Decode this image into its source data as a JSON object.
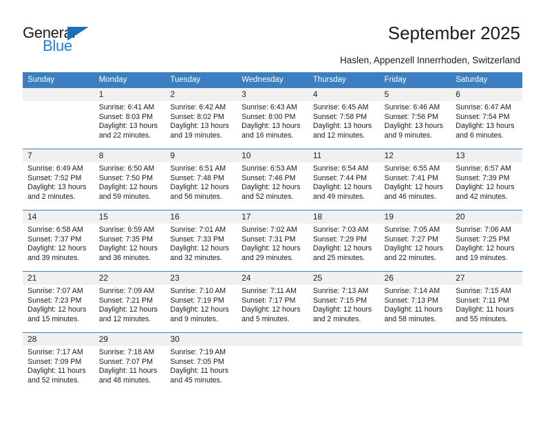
{
  "brand": {
    "word_one": "General",
    "word_two": "Blue",
    "triangle_icon": "triangle-icon",
    "accent_color": "#1c7fd6"
  },
  "header": {
    "title": "September 2025",
    "subtitle": "Haslen, Appenzell Innerrhoden, Switzerland"
  },
  "theme": {
    "header_blue": "#3c7fc1",
    "daynum_gray": "#f0f0f0",
    "text": "#1a1a1a"
  },
  "calendar": {
    "weekday_headers": [
      "Sunday",
      "Monday",
      "Tuesday",
      "Wednesday",
      "Thursday",
      "Friday",
      "Saturday"
    ],
    "weeks": [
      [
        {
          "day": "",
          "sunrise": "",
          "sunset": "",
          "daylight": "",
          "empty": true
        },
        {
          "day": "1",
          "sunrise": "Sunrise: 6:41 AM",
          "sunset": "Sunset: 8:03 PM",
          "daylight": "Daylight: 13 hours and 22 minutes."
        },
        {
          "day": "2",
          "sunrise": "Sunrise: 6:42 AM",
          "sunset": "Sunset: 8:02 PM",
          "daylight": "Daylight: 13 hours and 19 minutes."
        },
        {
          "day": "3",
          "sunrise": "Sunrise: 6:43 AM",
          "sunset": "Sunset: 8:00 PM",
          "daylight": "Daylight: 13 hours and 16 minutes."
        },
        {
          "day": "4",
          "sunrise": "Sunrise: 6:45 AM",
          "sunset": "Sunset: 7:58 PM",
          "daylight": "Daylight: 13 hours and 12 minutes."
        },
        {
          "day": "5",
          "sunrise": "Sunrise: 6:46 AM",
          "sunset": "Sunset: 7:56 PM",
          "daylight": "Daylight: 13 hours and 9 minutes."
        },
        {
          "day": "6",
          "sunrise": "Sunrise: 6:47 AM",
          "sunset": "Sunset: 7:54 PM",
          "daylight": "Daylight: 13 hours and 6 minutes."
        }
      ],
      [
        {
          "day": "7",
          "sunrise": "Sunrise: 6:49 AM",
          "sunset": "Sunset: 7:52 PM",
          "daylight": "Daylight: 13 hours and 2 minutes."
        },
        {
          "day": "8",
          "sunrise": "Sunrise: 6:50 AM",
          "sunset": "Sunset: 7:50 PM",
          "daylight": "Daylight: 12 hours and 59 minutes."
        },
        {
          "day": "9",
          "sunrise": "Sunrise: 6:51 AM",
          "sunset": "Sunset: 7:48 PM",
          "daylight": "Daylight: 12 hours and 56 minutes."
        },
        {
          "day": "10",
          "sunrise": "Sunrise: 6:53 AM",
          "sunset": "Sunset: 7:46 PM",
          "daylight": "Daylight: 12 hours and 52 minutes."
        },
        {
          "day": "11",
          "sunrise": "Sunrise: 6:54 AM",
          "sunset": "Sunset: 7:44 PM",
          "daylight": "Daylight: 12 hours and 49 minutes."
        },
        {
          "day": "12",
          "sunrise": "Sunrise: 6:55 AM",
          "sunset": "Sunset: 7:41 PM",
          "daylight": "Daylight: 12 hours and 46 minutes."
        },
        {
          "day": "13",
          "sunrise": "Sunrise: 6:57 AM",
          "sunset": "Sunset: 7:39 PM",
          "daylight": "Daylight: 12 hours and 42 minutes."
        }
      ],
      [
        {
          "day": "14",
          "sunrise": "Sunrise: 6:58 AM",
          "sunset": "Sunset: 7:37 PM",
          "daylight": "Daylight: 12 hours and 39 minutes."
        },
        {
          "day": "15",
          "sunrise": "Sunrise: 6:59 AM",
          "sunset": "Sunset: 7:35 PM",
          "daylight": "Daylight: 12 hours and 36 minutes."
        },
        {
          "day": "16",
          "sunrise": "Sunrise: 7:01 AM",
          "sunset": "Sunset: 7:33 PM",
          "daylight": "Daylight: 12 hours and 32 minutes."
        },
        {
          "day": "17",
          "sunrise": "Sunrise: 7:02 AM",
          "sunset": "Sunset: 7:31 PM",
          "daylight": "Daylight: 12 hours and 29 minutes."
        },
        {
          "day": "18",
          "sunrise": "Sunrise: 7:03 AM",
          "sunset": "Sunset: 7:29 PM",
          "daylight": "Daylight: 12 hours and 25 minutes."
        },
        {
          "day": "19",
          "sunrise": "Sunrise: 7:05 AM",
          "sunset": "Sunset: 7:27 PM",
          "daylight": "Daylight: 12 hours and 22 minutes."
        },
        {
          "day": "20",
          "sunrise": "Sunrise: 7:06 AM",
          "sunset": "Sunset: 7:25 PM",
          "daylight": "Daylight: 12 hours and 19 minutes."
        }
      ],
      [
        {
          "day": "21",
          "sunrise": "Sunrise: 7:07 AM",
          "sunset": "Sunset: 7:23 PM",
          "daylight": "Daylight: 12 hours and 15 minutes."
        },
        {
          "day": "22",
          "sunrise": "Sunrise: 7:09 AM",
          "sunset": "Sunset: 7:21 PM",
          "daylight": "Daylight: 12 hours and 12 minutes."
        },
        {
          "day": "23",
          "sunrise": "Sunrise: 7:10 AM",
          "sunset": "Sunset: 7:19 PM",
          "daylight": "Daylight: 12 hours and 9 minutes."
        },
        {
          "day": "24",
          "sunrise": "Sunrise: 7:11 AM",
          "sunset": "Sunset: 7:17 PM",
          "daylight": "Daylight: 12 hours and 5 minutes."
        },
        {
          "day": "25",
          "sunrise": "Sunrise: 7:13 AM",
          "sunset": "Sunset: 7:15 PM",
          "daylight": "Daylight: 12 hours and 2 minutes."
        },
        {
          "day": "26",
          "sunrise": "Sunrise: 7:14 AM",
          "sunset": "Sunset: 7:13 PM",
          "daylight": "Daylight: 11 hours and 58 minutes."
        },
        {
          "day": "27",
          "sunrise": "Sunrise: 7:15 AM",
          "sunset": "Sunset: 7:11 PM",
          "daylight": "Daylight: 11 hours and 55 minutes."
        }
      ],
      [
        {
          "day": "28",
          "sunrise": "Sunrise: 7:17 AM",
          "sunset": "Sunset: 7:09 PM",
          "daylight": "Daylight: 11 hours and 52 minutes."
        },
        {
          "day": "29",
          "sunrise": "Sunrise: 7:18 AM",
          "sunset": "Sunset: 7:07 PM",
          "daylight": "Daylight: 11 hours and 48 minutes."
        },
        {
          "day": "30",
          "sunrise": "Sunrise: 7:19 AM",
          "sunset": "Sunset: 7:05 PM",
          "daylight": "Daylight: 11 hours and 45 minutes."
        },
        {
          "day": "",
          "sunrise": "",
          "sunset": "",
          "daylight": "",
          "empty": true
        },
        {
          "day": "",
          "sunrise": "",
          "sunset": "",
          "daylight": "",
          "empty": true
        },
        {
          "day": "",
          "sunrise": "",
          "sunset": "",
          "daylight": "",
          "empty": true
        },
        {
          "day": "",
          "sunrise": "",
          "sunset": "",
          "daylight": "",
          "empty": true
        }
      ]
    ]
  }
}
